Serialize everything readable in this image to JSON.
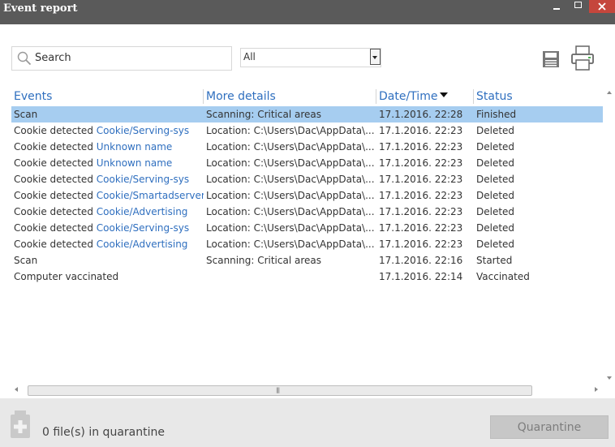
{
  "window": {
    "title": "Event report",
    "controls": [
      "minimize-icon",
      "maximize-icon",
      "close-icon"
    ]
  },
  "toolbar": {
    "search_placeholder": "Search",
    "filter_selected": "All",
    "icons": [
      "search-icon",
      "save-icon",
      "print-icon"
    ]
  },
  "table": {
    "columns": {
      "events": "Events",
      "details": "More details",
      "datetime": "Date/Time",
      "status": "Status"
    },
    "sorted_by": "datetime",
    "sort_direction": "descending",
    "rows": [
      {
        "event": "Scan",
        "link": "",
        "details": "Scanning: Critical areas",
        "datetime": "17.1.2016. 22:28",
        "status": "Finished",
        "selected": true
      },
      {
        "event": "Cookie detected",
        "link": "Cookie/Serving-sys",
        "details": "Location: C:\\Users\\Dac\\AppData\\...",
        "datetime": "17.1.2016. 22:23",
        "status": "Deleted"
      },
      {
        "event": "Cookie detected",
        "link": "Unknown name",
        "details": "Location: C:\\Users\\Dac\\AppData\\...",
        "datetime": "17.1.2016. 22:23",
        "status": "Deleted"
      },
      {
        "event": "Cookie detected",
        "link": "Unknown name",
        "details": "Location: C:\\Users\\Dac\\AppData\\...",
        "datetime": "17.1.2016. 22:23",
        "status": "Deleted"
      },
      {
        "event": "Cookie detected",
        "link": "Cookie/Serving-sys",
        "details": "Location: C:\\Users\\Dac\\AppData\\...",
        "datetime": "17.1.2016. 22:23",
        "status": "Deleted"
      },
      {
        "event": "Cookie detected",
        "link": "Cookie/Smartadserver",
        "details": "Location: C:\\Users\\Dac\\AppData\\...",
        "datetime": "17.1.2016. 22:23",
        "status": "Deleted"
      },
      {
        "event": "Cookie detected",
        "link": "Cookie/Advertising",
        "details": "Location: C:\\Users\\Dac\\AppData\\...",
        "datetime": "17.1.2016. 22:23",
        "status": "Deleted"
      },
      {
        "event": "Cookie detected",
        "link": "Cookie/Serving-sys",
        "details": "Location: C:\\Users\\Dac\\AppData\\...",
        "datetime": "17.1.2016. 22:23",
        "status": "Deleted"
      },
      {
        "event": "Cookie detected",
        "link": "Cookie/Advertising",
        "details": "Location: C:\\Users\\Dac\\AppData\\...",
        "datetime": "17.1.2016. 22:23",
        "status": "Deleted"
      },
      {
        "event": "Scan",
        "link": "",
        "details": "Scanning: Critical areas",
        "datetime": "17.1.2016. 22:16",
        "status": "Started"
      },
      {
        "event": "Computer vaccinated",
        "link": "",
        "details": "",
        "datetime": "17.1.2016. 22:14",
        "status": "Vaccinated"
      }
    ]
  },
  "footer": {
    "quarantine_count": "0 file(s) in quarantine",
    "quarantine_button": "Quarantine",
    "quarantine_icon": "quarantine-icon"
  },
  "colors": {
    "titlebar": "#5a5a5a",
    "close_button": "#c5463c",
    "link": "#2f6fbf",
    "selected_row": "#a6cdf0",
    "footer": "#e8e8e8",
    "button_disabled": "#c7c7c7"
  }
}
